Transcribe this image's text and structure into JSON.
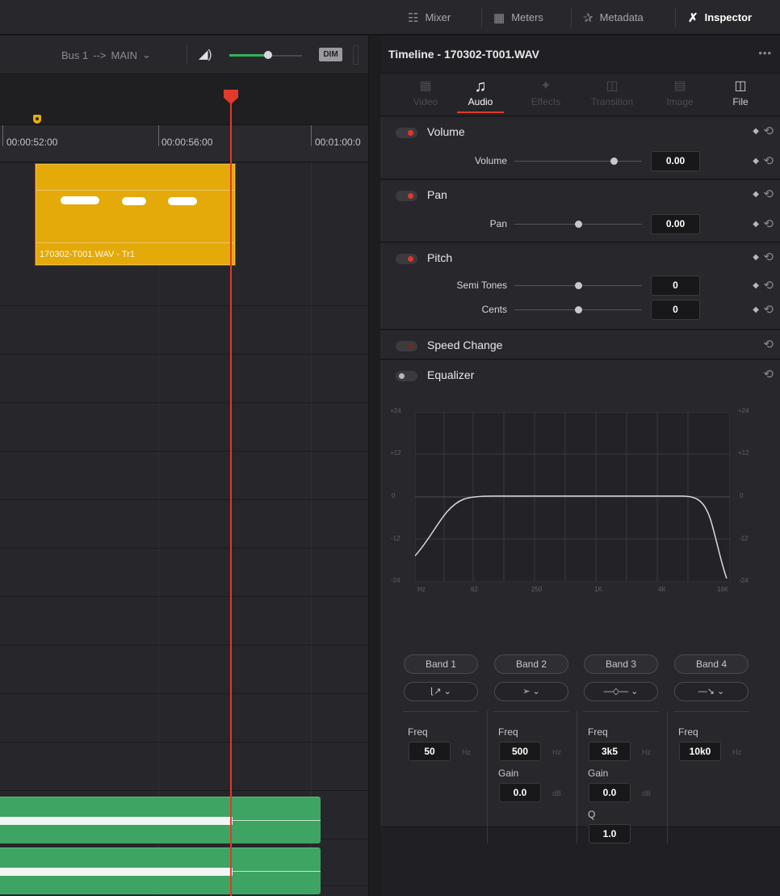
{
  "topbar": {
    "mixer": "Mixer",
    "meters": "Meters",
    "metadata": "Metadata",
    "inspector": "Inspector"
  },
  "timeline": {
    "bus": "Bus 1",
    "arrow": "-->",
    "output": "MAIN",
    "dim": "DIM",
    "timecodes": [
      "00:00:52:00",
      "00:00:56:00",
      "00:01:00:0"
    ],
    "clip_name": "170302-T001.WAV - Tr1"
  },
  "inspector": {
    "title": "Timeline - 170302-T001.WAV",
    "tabs": [
      "Video",
      "Audio",
      "Effects",
      "Transition",
      "Image",
      "File"
    ],
    "active_tab": "Audio",
    "volume": {
      "title": "Volume",
      "label": "Volume",
      "value": "0.00"
    },
    "pan": {
      "title": "Pan",
      "label": "Pan",
      "value": "0.00"
    },
    "pitch": {
      "title": "Pitch",
      "semi_label": "Semi Tones",
      "semi_value": "0",
      "cents_label": "Cents",
      "cents_value": "0"
    },
    "speed": {
      "title": "Speed Change"
    },
    "eq": {
      "title": "Equalizer",
      "y_labels": [
        "+24",
        "+12",
        "0",
        "-12",
        "-24"
      ],
      "x_labels": [
        "Hz",
        "62",
        "250",
        "1K",
        "4K",
        "16K"
      ],
      "bands": [
        {
          "name": "Band 1",
          "freq_label": "Freq",
          "freq": "50",
          "unit": "Hz"
        },
        {
          "name": "Band 2",
          "freq_label": "Freq",
          "freq": "500",
          "unit": "Hz",
          "gain_label": "Gain",
          "gain": "0.0",
          "gain_unit": "dB"
        },
        {
          "name": "Band 3",
          "freq_label": "Freq",
          "freq": "3k5",
          "unit": "Hz",
          "gain_label": "Gain",
          "gain": "0.0",
          "gain_unit": "dB",
          "q_label": "Q",
          "q": "1.0"
        },
        {
          "name": "Band 4",
          "freq_label": "Freq",
          "freq": "10k0",
          "unit": "Hz"
        }
      ]
    }
  },
  "colors": {
    "accent": "#e03a2c",
    "clip_audio": "#e3aa0a",
    "clip_green": "#3ea464"
  }
}
